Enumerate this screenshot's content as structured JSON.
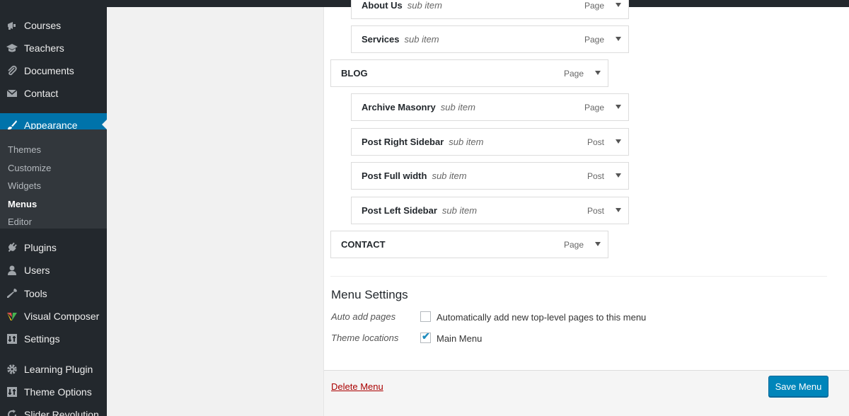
{
  "sidebar": {
    "items": [
      {
        "label": "Courses",
        "icon": "megaphone-icon"
      },
      {
        "label": "Teachers",
        "icon": "graduation-cap-icon"
      },
      {
        "label": "Documents",
        "icon": "paperclip-icon"
      },
      {
        "label": "Contact",
        "icon": "envelope-icon"
      },
      {
        "label": "Appearance",
        "icon": "paintbrush-icon"
      },
      {
        "label": "Plugins",
        "icon": "plug-icon"
      },
      {
        "label": "Users",
        "icon": "user-icon"
      },
      {
        "label": "Tools",
        "icon": "wrench-icon"
      },
      {
        "label": "Visual Composer",
        "icon": "visual-composer-icon"
      },
      {
        "label": "Settings",
        "icon": "settings-icon"
      },
      {
        "label": "Learning Plugin",
        "icon": "gear-icon"
      },
      {
        "label": "Theme Options",
        "icon": "settings-icon"
      },
      {
        "label": "Slider Revolution",
        "icon": "refresh-icon"
      }
    ],
    "submenu": [
      "Themes",
      "Customize",
      "Widgets",
      "Menus",
      "Editor"
    ]
  },
  "menu_items": [
    {
      "title": "About Us",
      "sub": "sub item",
      "type": "Page"
    },
    {
      "title": "Services",
      "sub": "sub item",
      "type": "Page"
    },
    {
      "title": "BLOG",
      "sub": "",
      "type": "Page"
    },
    {
      "title": "Archive Masonry",
      "sub": "sub item",
      "type": "Page"
    },
    {
      "title": "Post Right Sidebar",
      "sub": "sub item",
      "type": "Post"
    },
    {
      "title": "Post Full width",
      "sub": "sub item",
      "type": "Post"
    },
    {
      "title": "Post Left Sidebar",
      "sub": "sub item",
      "type": "Post"
    },
    {
      "title": "CONTACT",
      "sub": "",
      "type": "Page"
    }
  ],
  "settings": {
    "title": "Menu Settings",
    "auto_add_label": "Auto add pages",
    "auto_add_text": "Automatically add new top-level pages to this menu",
    "auto_add_checked": false,
    "locations_label": "Theme locations",
    "main_menu_text": "Main Menu",
    "main_menu_checked": true
  },
  "footer": {
    "delete_label": "Delete Menu",
    "save_label": "Save Menu"
  },
  "colors": {
    "accent": "#0073aa",
    "button": "#0085ba",
    "delete": "#aa0000"
  }
}
